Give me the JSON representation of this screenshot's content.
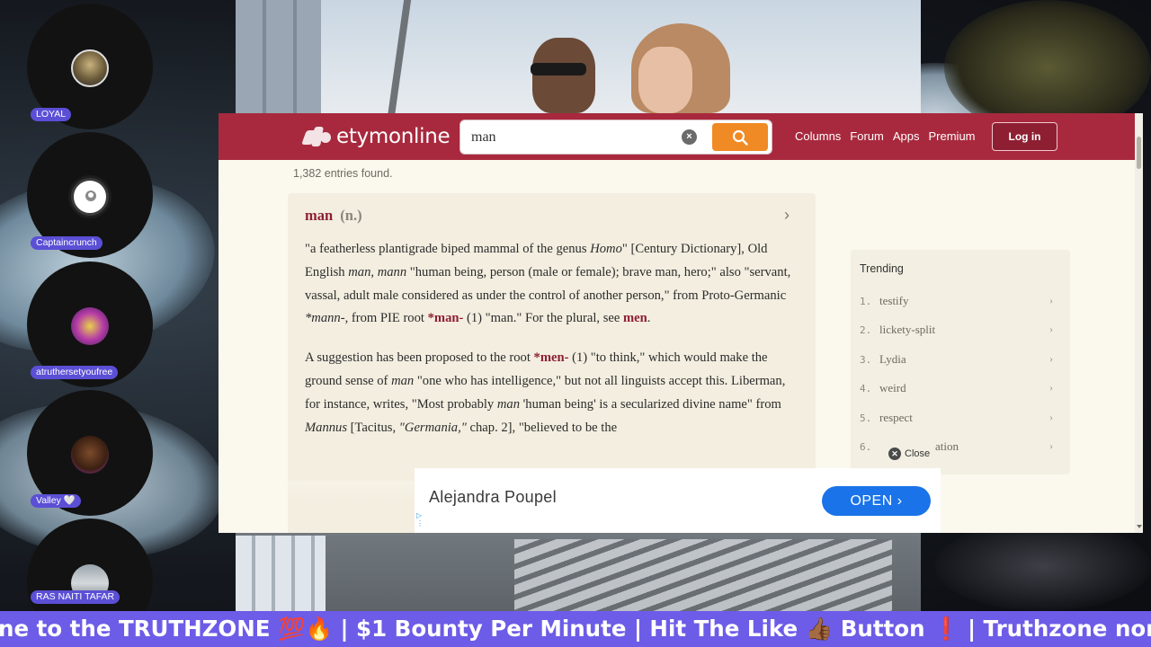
{
  "stream": {
    "participants": [
      {
        "name": "LOYAL"
      },
      {
        "name": "Captaincrunch"
      },
      {
        "name": "atruthersetyoufree"
      },
      {
        "name": "Valley 🤍"
      },
      {
        "name": "RAS NAITI TAFAR"
      }
    ],
    "ticker": "ne to the TRUTHZONE 💯🔥 | $1 Bounty Per Minute | Hit The Like 👍🏾 Button ❗ | Truthzone nor co-host is resp"
  },
  "site": {
    "logo": "etymonline",
    "search": {
      "value": "man",
      "clear": "×"
    },
    "nav": [
      "Columns",
      "Forum",
      "Apps",
      "Premium"
    ],
    "login": "Log in",
    "entries_found": "1,382 entries found."
  },
  "entry": {
    "word": "man",
    "pos": "(n.)",
    "p1": {
      "s1": "\"a featherless plantigrade biped mammal of the genus ",
      "i1": "Homo",
      "s2": "\" [Century Dictionary], Old English ",
      "i2": "man",
      "s3": ", ",
      "i3": "mann",
      "s4": " \"human being, person (male or female); brave man, hero;\" also \"servant, vassal, adult male considered as under the control of another person,\" from Proto-Germanic ",
      "i4": "*mann-",
      "s5": ", from PIE root ",
      "x1": "*man-",
      "s6": " (1) \"man.\" For the plural, see ",
      "x2": "men",
      "s7": "."
    },
    "p2": {
      "s1": "A suggestion has been proposed to the root ",
      "x1": "*men-",
      "s2": " (1) \"to think,\" which would make the ground sense of ",
      "i1": "man",
      "s3": " \"one who has intelligence,\" but not all linguists accept this. Liberman, for instance, writes, \"Most probably ",
      "i2": "man",
      "s4": " 'human being' is a secularized divine name\" from ",
      "i3": "Mannus",
      "s5": " [Tacitus, ",
      "i4": "\"Germania,\"",
      "s6": " chap. 2], \"believed to be the"
    }
  },
  "trending": {
    "title": "Trending",
    "items": [
      {
        "num": "1.",
        "word": "testify"
      },
      {
        "num": "2.",
        "word": "lickety-split"
      },
      {
        "num": "3.",
        "word": "Lydia"
      },
      {
        "num": "4.",
        "word": "weird"
      },
      {
        "num": "5.",
        "word": "respect"
      },
      {
        "num": "6.",
        "word": "ation"
      }
    ]
  },
  "close_label": "Close",
  "ad": {
    "name": "Alejandra Poupel",
    "cta": "OPEN ›"
  },
  "icons": {
    "search": "search-icon",
    "clear": "clear-icon",
    "chevron": "chevron-right-icon",
    "close": "close-icon",
    "adchoices": "adchoices-icon"
  },
  "colors": {
    "header": "#a8293d",
    "search_button": "#f08a24",
    "link": "#8e1f32",
    "ad_cta": "#1a73e8",
    "ticker": "#6c5ce7"
  }
}
